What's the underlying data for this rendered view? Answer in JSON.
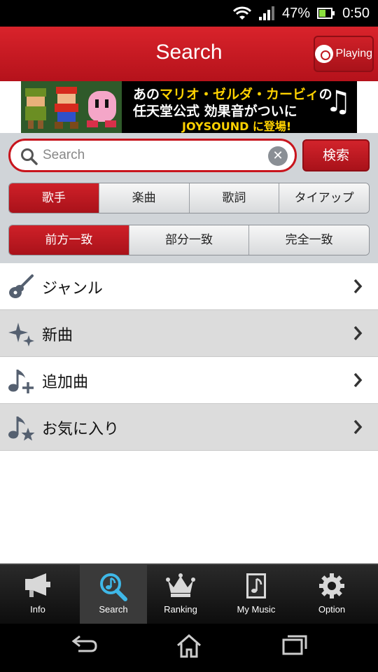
{
  "status_bar": {
    "battery": "47%",
    "time": "0:50"
  },
  "header": {
    "title": "Search",
    "playing_label": "Playing"
  },
  "banner": {
    "line1_pre": "あの",
    "line1_highlight": "マリオ・ゼルダ・カービィ",
    "line1_post": "の",
    "line2": "任天堂公式 効果音がついに",
    "line3": "JOYSOUND に登場!"
  },
  "search": {
    "placeholder": "Search",
    "button_label": "検索"
  },
  "category_tabs": [
    "歌手",
    "楽曲",
    "歌詞",
    "タイアップ"
  ],
  "match_tabs": [
    "前方一致",
    "部分一致",
    "完全一致"
  ],
  "list": [
    {
      "label": "ジャンル",
      "icon": "guitar-icon"
    },
    {
      "label": "新曲",
      "icon": "sparkle-icon"
    },
    {
      "label": "追加曲",
      "icon": "music-note-plus-icon"
    },
    {
      "label": "お気に入り",
      "icon": "music-note-star-icon"
    }
  ],
  "tabbar": [
    {
      "label": "Info",
      "icon": "megaphone-icon"
    },
    {
      "label": "Search",
      "icon": "search-note-icon"
    },
    {
      "label": "Ranking",
      "icon": "crown-icon"
    },
    {
      "label": "My Music",
      "icon": "music-file-icon"
    },
    {
      "label": "Option",
      "icon": "gear-icon"
    }
  ],
  "colors": {
    "brand_red": "#c8151d",
    "active_tab_icon": "#3fb8e8"
  }
}
